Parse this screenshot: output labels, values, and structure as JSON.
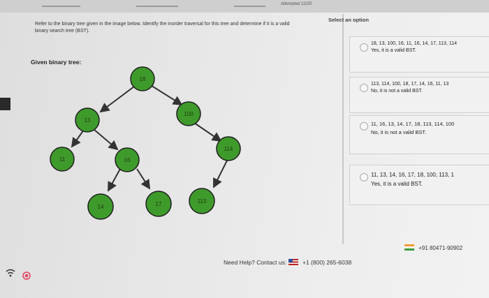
{
  "header": {
    "attempted": "Attempted 12/25"
  },
  "question": {
    "text": "Refer to the binary tree given in the image below. Identify the inorder traversal for this tree and determine if it is a valid binary search tree (BST).",
    "given_label": "Given binary tree:"
  },
  "tree": {
    "nodes": {
      "root": "18",
      "left": "13",
      "right": "100",
      "left_left": "11",
      "left_right": "16",
      "right_right": "114",
      "lr_left": "14",
      "lr_right": "17",
      "rr_left": "113"
    },
    "node_fill": "#3f9a2c",
    "node_stroke": "#1f1f1f"
  },
  "options": {
    "title": "Select an option",
    "items": [
      {
        "line1": "18, 13, 100, 16, 11, 16, 14, 17, 113, 114",
        "line2": "Yes, it is a valid BST."
      },
      {
        "line1": "113, 114, 100, 18, 17, 14, 16, 11, 13",
        "line2": "No, it is not a valid BST."
      },
      {
        "line1": "11, 16, 13, 14, 17, 18, 113, 114, 100",
        "line2": "No, it is not a valid BST."
      },
      {
        "line1": "11, 13, 14, 16, 17, 18, 100, 113, 1",
        "line2": "Yes, it is a valid BST."
      }
    ]
  },
  "footer": {
    "need_help": "Need Help? Contact us:",
    "phone_us": "+1 (800) 265-6038",
    "phone_in": "+91 80471-90902"
  }
}
